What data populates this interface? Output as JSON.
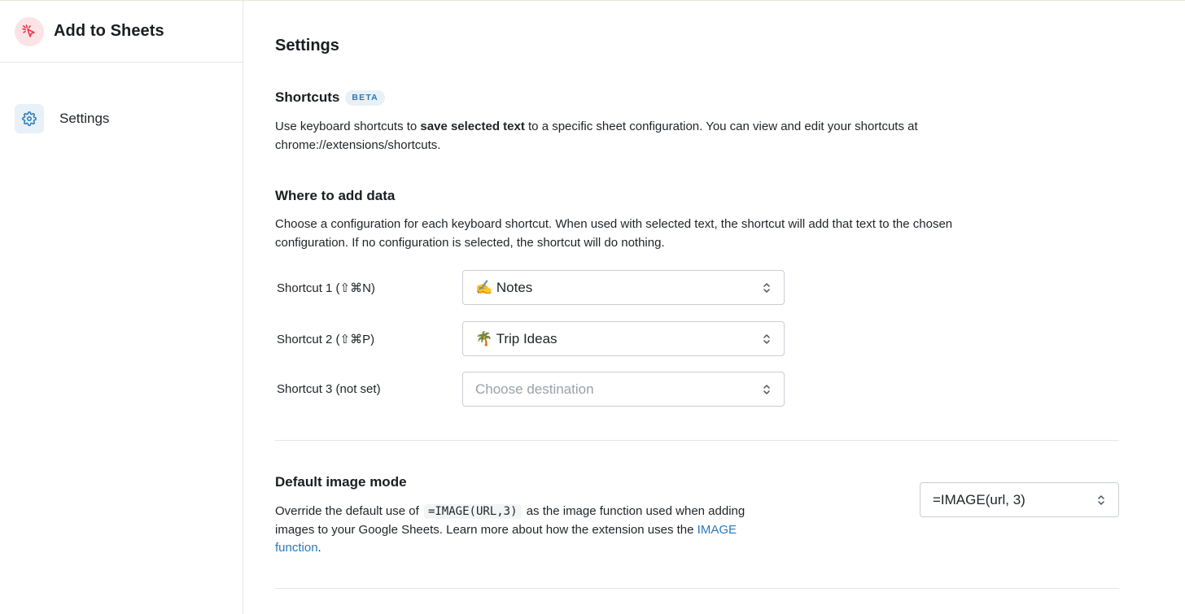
{
  "app": {
    "name": "Add to Sheets",
    "logo_icon": "cursor-sparkle-icon",
    "accent": "#e8394a",
    "link_color": "#2a78b8"
  },
  "sidebar": {
    "items": [
      {
        "label": "Settings",
        "icon": "gear-icon",
        "active": true
      }
    ]
  },
  "main": {
    "title": "Settings",
    "shortcuts": {
      "heading": "Shortcuts",
      "badge": "BETA",
      "desc_before": "Use keyboard shortcuts to ",
      "desc_bold": "save selected text",
      "desc_after": " to a specific sheet configuration. You can view and edit your shortcuts at chrome://extensions/shortcuts."
    },
    "where": {
      "heading": "Where to add data",
      "desc": "Choose a configuration for each keyboard shortcut. When used with selected text, the shortcut will add that text to the chosen configuration. If no configuration is selected, the shortcut will do nothing.",
      "rows": [
        {
          "label": "Shortcut 1 (⇧⌘N)",
          "value": "✍️ Notes",
          "placeholder": ""
        },
        {
          "label": "Shortcut 2 (⇧⌘P)",
          "value": "🌴 Trip Ideas",
          "placeholder": ""
        },
        {
          "label": "Shortcut 3 (not set)",
          "value": "",
          "placeholder": "Choose destination"
        }
      ]
    },
    "image_mode": {
      "heading": "Default image mode",
      "desc_before": "Override the default use of",
      "code": "=IMAGE(URL,3)",
      "desc_middle": "as the image function used when adding images to your Google Sheets. Learn more about how the extension uses the ",
      "link_text": "IMAGE function",
      "desc_after": ".",
      "selected": "=IMAGE(url, 3)"
    }
  }
}
